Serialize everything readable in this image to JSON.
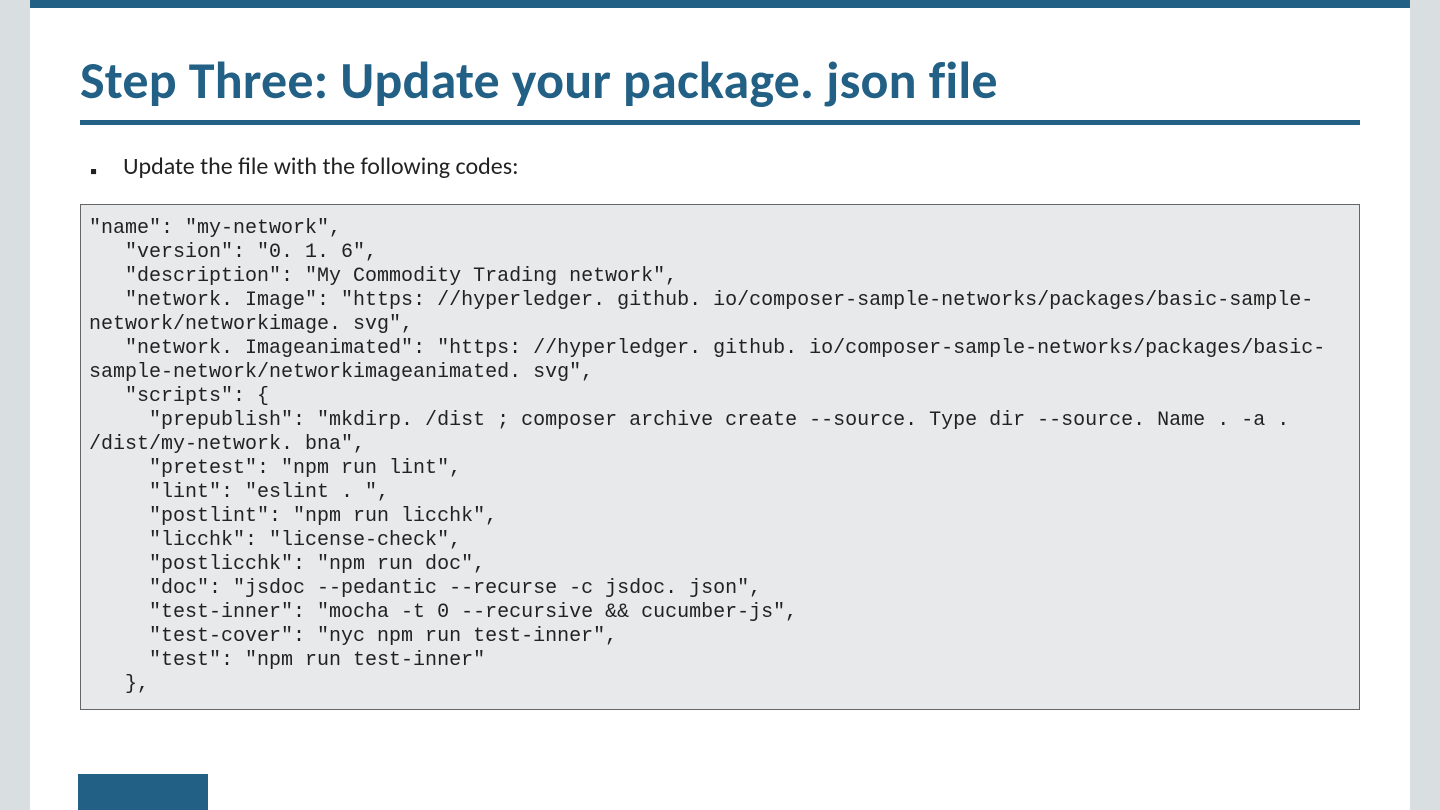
{
  "slide": {
    "title": "Step Three: Update your package. json file",
    "bullet": "Update the file with the following codes:",
    "code": "\"name\": \"my-network\",\n   \"version\": \"0. 1. 6\",\n   \"description\": \"My Commodity Trading network\",\n   \"network. Image\": \"https: //hyperledger. github. io/composer-sample-networks/packages/basic-sample-network/networkimage. svg\",\n   \"network. Imageanimated\": \"https: //hyperledger. github. io/composer-sample-networks/packages/basic-sample-network/networkimageanimated. svg\",\n   \"scripts\": {\n     \"prepublish\": \"mkdirp. /dist ; composer archive create --source. Type dir --source. Name . -a . /dist/my-network. bna\",\n     \"pretest\": \"npm run lint\",\n     \"lint\": \"eslint . \",\n     \"postlint\": \"npm run licchk\",\n     \"licchk\": \"license-check\",\n     \"postlicchk\": \"npm run doc\",\n     \"doc\": \"jsdoc --pedantic --recurse -c jsdoc. json\",\n     \"test-inner\": \"mocha -t 0 --recursive && cucumber-js\",\n     \"test-cover\": \"nyc npm run test-inner\",\n     \"test\": \"npm run test-inner\"\n   },"
  },
  "colors": {
    "accent": "#226085",
    "page_bg": "#d9dfe1",
    "code_bg": "#e8e9ea"
  }
}
